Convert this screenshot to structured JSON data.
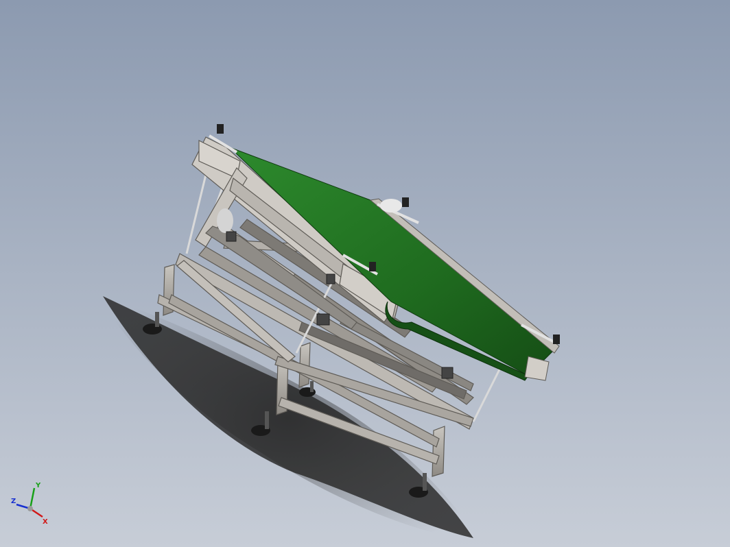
{
  "viewport": {
    "background_top": "#8c9ab0",
    "background_bottom": "#c7cdd7"
  },
  "model": {
    "belt_color": "#1f6b1f",
    "frame_color": "#a7a39c",
    "shadow_color": "#2b2b2b",
    "foot_color": "#1a1a1a"
  },
  "triad": {
    "x_label": "X",
    "y_label": "Y",
    "z_label": "Z",
    "x_color": "#d01818",
    "y_color": "#18a018",
    "z_color": "#1830d0"
  }
}
